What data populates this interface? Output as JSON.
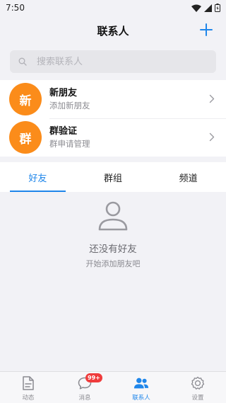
{
  "status_bar": {
    "time": "7:50"
  },
  "header": {
    "title": "联系人",
    "add_icon": "plus-icon"
  },
  "search": {
    "placeholder": "搜索联系人",
    "value": ""
  },
  "entries": [
    {
      "avatar_text": "新",
      "title": "新朋友",
      "subtitle": "添加新朋友"
    },
    {
      "avatar_text": "群",
      "title": "群验证",
      "subtitle": "群申请管理"
    }
  ],
  "tabs": [
    {
      "label": "好友",
      "active": true
    },
    {
      "label": "群组",
      "active": false
    },
    {
      "label": "频道",
      "active": false
    }
  ],
  "empty_state": {
    "icon": "person-icon",
    "title": "还没有好友",
    "subtitle": "开始添加朋友吧"
  },
  "bottom_nav": {
    "items": [
      {
        "label": "动态",
        "icon": "document-icon"
      },
      {
        "label": "消息",
        "icon": "chat-icon",
        "badge": "99+"
      },
      {
        "label": "联系人",
        "icon": "contacts-icon",
        "active": true
      },
      {
        "label": "设置",
        "icon": "gear-icon"
      }
    ]
  },
  "colors": {
    "accent": "#1f86ea",
    "avatar": "#fb8c1a",
    "badge": "#ef3c3c",
    "background": "#f2f2f6"
  }
}
